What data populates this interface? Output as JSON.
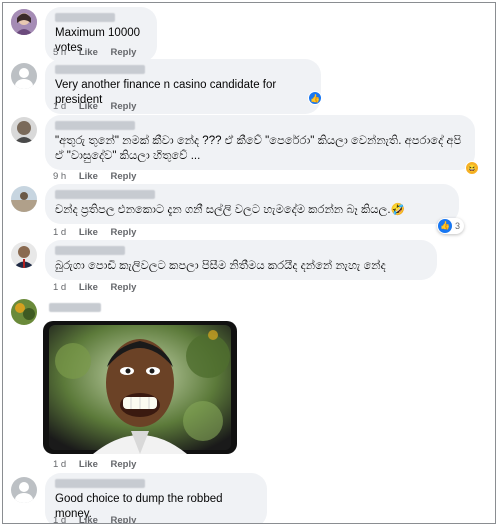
{
  "comments": [
    {
      "text": "Maximum 10000 votes",
      "time": "5 h",
      "like": "Like",
      "reply": "Reply"
    },
    {
      "text": "Very another finance n casino candidate for president",
      "time": "1 d",
      "like": "Like",
      "reply": "Reply"
    },
    {
      "text": "\"අතුරු තුනේ\" නමක් කීවා නේද ??? ඒ කීවේ \"පෙරේරා\" කියලා වෙන්නැති. අපරාදේ අපි ඒ \"වාසුදේව\" කියලා හිතුවේ ...",
      "time": "9 h",
      "like": "Like",
      "reply": "Reply"
    },
    {
      "text": "චන්ද ප්‍රතිපල එනකොට දැන ගනී සල්ලි වලට හැමදේම කරන්න බෑ කියල.🤣",
      "time": "1 d",
      "like": "Like",
      "reply": "Reply",
      "reaction_count": "3"
    },
    {
      "text": "බුරුගා පොඩි කැලිවලට කපලා පිසීම නිතීමය කරයීද දන්නේ නැහැ නේද",
      "time": "1 d",
      "like": "Like",
      "reply": "Reply"
    },
    {
      "time": "1 d",
      "like": "Like",
      "reply": "Reply"
    },
    {
      "text": "Good choice to dump the robbed money.",
      "time": "1 d",
      "like": "Like",
      "reply": "Reply"
    }
  ],
  "icons": {
    "like_reaction": "thumbs-up-icon",
    "haha_reaction": "laughing-face-icon"
  },
  "colors": {
    "bubble": "#f0f2f5",
    "meta": "#65676b",
    "like_blue": "#1877f2"
  }
}
